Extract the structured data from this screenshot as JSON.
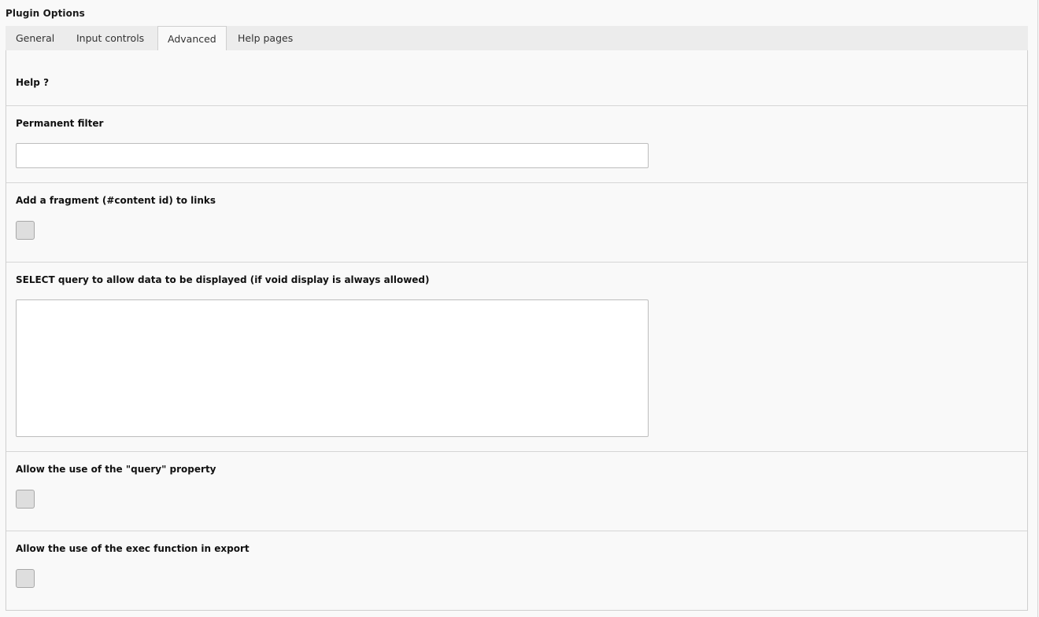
{
  "page": {
    "title": "Plugin Options"
  },
  "tabs": [
    {
      "label": "General",
      "active": false
    },
    {
      "label": "Input controls",
      "active": false
    },
    {
      "label": "Advanced",
      "active": true
    },
    {
      "label": "Help pages",
      "active": false
    }
  ],
  "sections": {
    "help": {
      "label": "Help ?"
    },
    "permanent_filter": {
      "label": "Permanent filter",
      "value": "",
      "placeholder": ""
    },
    "fragment": {
      "label": "Add a fragment (#content id) to links",
      "checked": false
    },
    "select_query": {
      "label": "SELECT query to allow data to be displayed (if void display is always allowed)",
      "value": ""
    },
    "query_property": {
      "label": "Allow the use of the \"query\" property",
      "checked": false
    },
    "exec_function": {
      "label": "Allow the use of the exec function in export",
      "checked": false
    }
  }
}
